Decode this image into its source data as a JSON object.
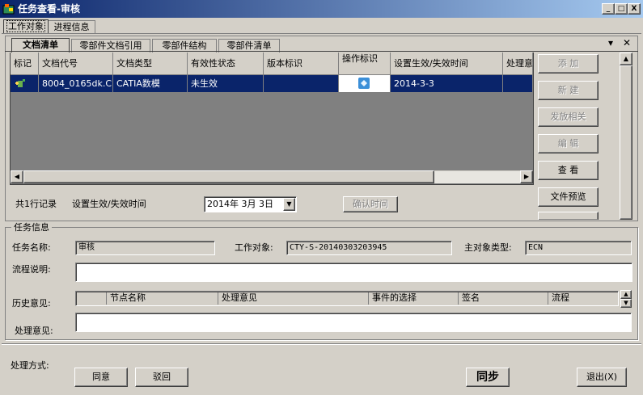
{
  "window": {
    "title": "任务查看-审核",
    "controls": [
      "_",
      "□",
      "X"
    ]
  },
  "main_tabs": [
    {
      "label": "工作对象"
    },
    {
      "label": "进程信息"
    }
  ],
  "sub_tabs": [
    {
      "label": "文档清单"
    },
    {
      "label": "零部件文档引用"
    },
    {
      "label": "零部件结构"
    },
    {
      "label": "零部件清单"
    }
  ],
  "panel_controls": {
    "pin": "▾",
    "close": "✕"
  },
  "grid": {
    "columns": [
      "标记",
      "文档代号",
      "文档类型",
      "有效性状态",
      "版本标识",
      "操作标识",
      "设置生效/失效时间",
      "处理意"
    ],
    "rows": [
      {
        "mark_icon": "add-doc-icon",
        "code": "8004_0165dk.C...",
        "type": "CATIA数模",
        "status": "未生效",
        "version": "",
        "op_icon": "operation-icon",
        "date": "2014-3-3",
        "handle": ""
      }
    ]
  },
  "side_buttons": [
    {
      "label": "添 加",
      "enabled": false
    },
    {
      "label": "新 建",
      "enabled": false
    },
    {
      "label": "发放相关",
      "enabled": false
    },
    {
      "label": "编 辑",
      "enabled": false
    },
    {
      "label": "查 看",
      "enabled": true
    },
    {
      "label": "文件预览",
      "enabled": true
    }
  ],
  "record_bar": {
    "count_text": "共1行记录",
    "date_label": "设置生效/失效时间",
    "date_value": "2014年 3月 3日",
    "confirm_label": "确认时间"
  },
  "task_info": {
    "group_title": "任务信息",
    "name_label": "任务名称:",
    "name_value": "审核",
    "object_label": "工作对象:",
    "object_value": "CTY-S-20140303203945",
    "main_type_label": "主对象类型:",
    "main_type_value": "ECN",
    "process_label": "流程说明:",
    "process_value": "",
    "history_label": "历史意见:",
    "history_columns": [
      "节点名称",
      "处理意见",
      "事件的选择",
      "签名",
      "流程"
    ],
    "opinion_label": "处理意见:",
    "opinion_value": ""
  },
  "footer": {
    "method_label": "处理方式:",
    "approve_label": "同意",
    "reject_label": "驳回",
    "sync_label": "同步",
    "exit_label": "退出(X)"
  },
  "colors": {
    "title_start": "#0a246a",
    "title_end": "#a6caf0",
    "selection": "#0a246a",
    "face": "#d4d0c8"
  }
}
